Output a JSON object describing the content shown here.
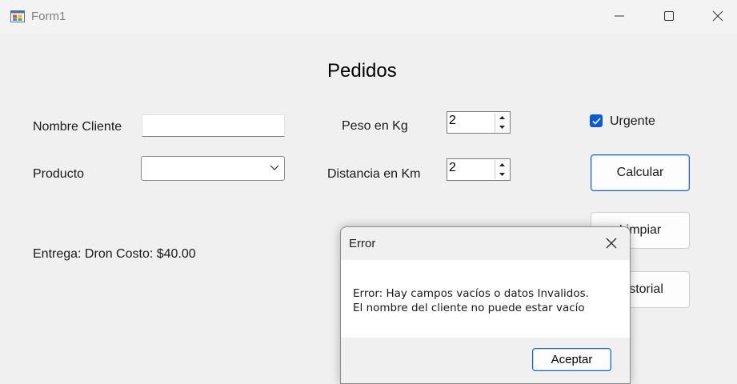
{
  "window": {
    "title": "Form1",
    "icons": [
      "form-icon",
      "minimize-icon",
      "maximize-icon",
      "close-icon"
    ]
  },
  "form": {
    "heading": "Pedidos",
    "nombre_label": "Nombre Cliente",
    "nombre_value": "",
    "producto_label": "Producto",
    "producto_value": "",
    "peso_label": "Peso en Kg",
    "peso_value": "2",
    "distancia_label": "Distancia en Km",
    "distancia_value": "2",
    "urgente_label": "Urgente",
    "urgente_checked": true,
    "calcular_label": "Calcular",
    "limpiar_label": "Limpiar",
    "historial_label": "Historial",
    "result": "Entrega: Dron Costo: $40.00"
  },
  "dialog": {
    "title": "Error",
    "line1": "Error: Hay campos vacíos o datos Invalidos.",
    "line2": "El nombre del cliente no puede estar vacío",
    "ok_label": "Aceptar"
  },
  "colors": {
    "accent": "#0a5ad6",
    "window_bg": "#f0f0f0",
    "primary_border": "#1f63b8"
  }
}
